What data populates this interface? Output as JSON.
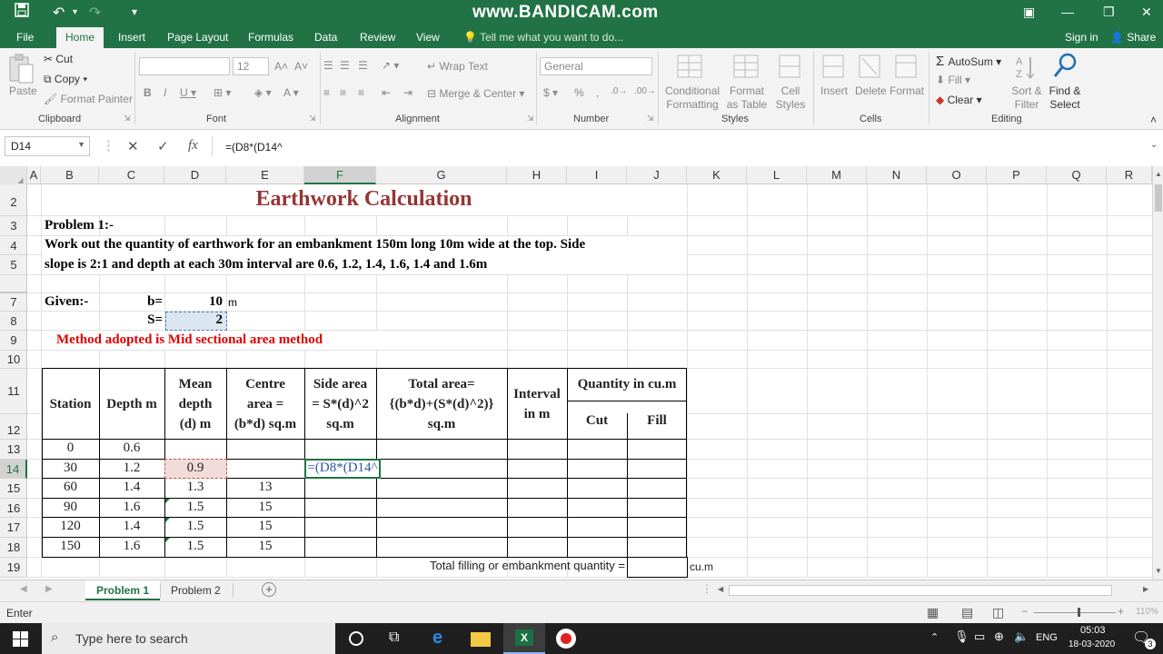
{
  "titlebar": {
    "watermark": "www.BANDICAM.com",
    "save_icon": "save-icon",
    "undo_icon": "undo-icon",
    "redo_icon": "redo-icon"
  },
  "ribbon_tabs": [
    "File",
    "Home",
    "Insert",
    "Page Layout",
    "Formulas",
    "Data",
    "Review",
    "View"
  ],
  "tell_me": "Tell me what you want to do...",
  "account": {
    "signin": "Sign in",
    "share": "Share"
  },
  "ribbon": {
    "clipboard": {
      "paste": "Paste",
      "cut": "Cut",
      "copy": "Copy",
      "format_painter": "Format Painter",
      "label": "Clipboard"
    },
    "font": {
      "size": "12",
      "label": "Font"
    },
    "alignment": {
      "wrap": "Wrap Text",
      "merge": "Merge & Center",
      "label": "Alignment"
    },
    "number": {
      "format": "General",
      "label": "Number"
    },
    "styles": {
      "conditional": "Conditional Formatting",
      "format_table": "Format as Table",
      "cell_styles": "Cell Styles",
      "label": "Styles"
    },
    "cells": {
      "insert": "Insert",
      "delete": "Delete",
      "format": "Format",
      "label": "Cells"
    },
    "editing": {
      "autosum": "AutoSum",
      "fill": "Fill",
      "clear": "Clear",
      "sort": "Sort & Filter",
      "find": "Find & Select",
      "label": "Editing"
    }
  },
  "formula_bar": {
    "name_box": "D14",
    "formula": "=(D8*(D14^"
  },
  "columns": [
    "A",
    "B",
    "C",
    "D",
    "E",
    "F",
    "G",
    "H",
    "I",
    "J",
    "K",
    "L",
    "M",
    "N",
    "O",
    "P",
    "Q",
    "R"
  ],
  "rows": [
    "2",
    "3",
    "4",
    "5",
    "7",
    "8",
    "9",
    "10",
    "11",
    "12",
    "13",
    "14",
    "15",
    "16",
    "17",
    "18",
    "19"
  ],
  "sheet": {
    "title": "Earthwork Calculation",
    "problem": "Problem 1:-",
    "statement_1": "Work out the quantity of earthwork for an embankment 150m long 10m wide at the top. Side",
    "statement_2": "slope is 2:1 and depth at each 30m interval are 0.6, 1.2, 1.4, 1.6, 1.4 and 1.6m",
    "given": "Given:-",
    "b_label": "b=",
    "b_value": "10",
    "b_unit": "m",
    "s_label": "S=",
    "s_value": "2",
    "method": "Method adopted is Mid sectional area method",
    "headers": {
      "station": "Station",
      "depth": "Depth m",
      "mean_1": "Mean",
      "mean_2": "depth",
      "mean_3": "(d) m",
      "centre_1": "Centre",
      "centre_2": "area =",
      "centre_3": "(b*d) sq.m",
      "side_1": "Side area",
      "side_2": "= S*(d)^2",
      "side_3": "sq.m",
      "total_1": "Total area=",
      "total_2": "{(b*d)+(S*(d)^2)}",
      "total_3": "sq.m",
      "interval_1": "Interval",
      "interval_2": "in m",
      "quantity": "Quantity in cu.m",
      "cut": "Cut",
      "fill": "Fill"
    },
    "data_rows": [
      {
        "station": "0",
        "depth": "0.6",
        "mean": "",
        "centre": ""
      },
      {
        "station": "30",
        "depth": "1.2",
        "mean": "0.9",
        "centre": ""
      },
      {
        "station": "60",
        "depth": "1.4",
        "mean": "1.3",
        "centre": "13"
      },
      {
        "station": "90",
        "depth": "1.6",
        "mean": "1.5",
        "centre": "15"
      },
      {
        "station": "120",
        "depth": "1.4",
        "mean": "1.5",
        "centre": "15"
      },
      {
        "station": "150",
        "depth": "1.6",
        "mean": "1.5",
        "centre": "15"
      }
    ],
    "editing_formula": "=(D8*(D14^",
    "total_label": "Total filling or embankment quantity =",
    "total_unit": "cu.m"
  },
  "sheet_tabs": [
    "Problem 1",
    "Problem 2"
  ],
  "status": {
    "mode": "Enter",
    "zoom": "110%"
  },
  "taskbar": {
    "search_placeholder": "Type here to search",
    "language": "ENG",
    "time": "05:03",
    "date": "18-03-2020",
    "notifications": "3"
  }
}
